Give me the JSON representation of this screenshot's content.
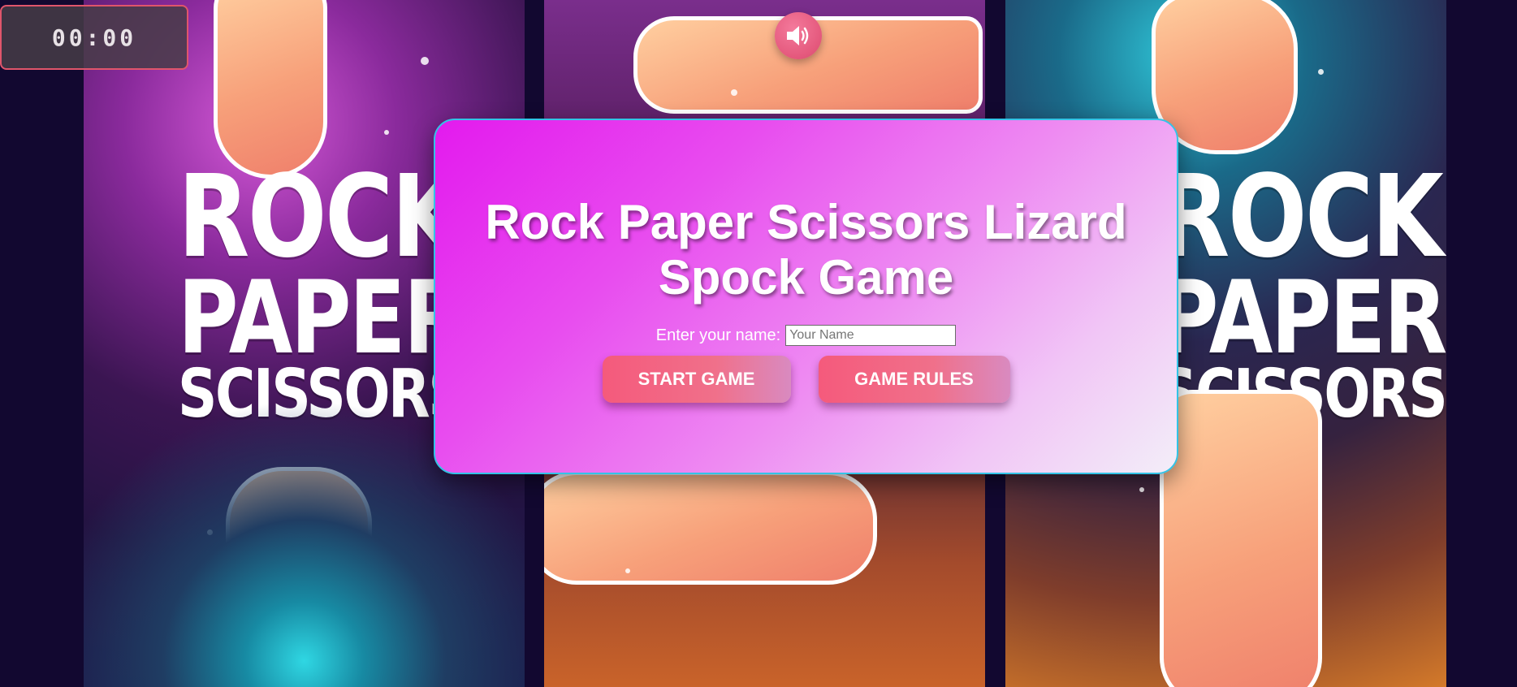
{
  "timer": {
    "text": "00:00"
  },
  "background": {
    "panels": [
      {
        "words": [
          "ROCK",
          "PAPER",
          "SCISSORS"
        ]
      },
      {
        "words": []
      },
      {
        "words": [
          "ROCK",
          "PAPER",
          "SCISSORS"
        ]
      }
    ]
  },
  "sound": {
    "icon": "speaker-icon"
  },
  "modal": {
    "title": "Rock Paper Scissors Lizard Spock Game",
    "name_label": "Enter your name:",
    "name_value": "",
    "name_placeholder": "Your Name",
    "start_button": "START GAME",
    "rules_button": "GAME RULES"
  },
  "colors": {
    "modal_border": "#33c3e6",
    "button_pink": "#f55a7c",
    "modal_gradient_start": "#e31aee",
    "modal_gradient_end": "#f3eef8"
  }
}
